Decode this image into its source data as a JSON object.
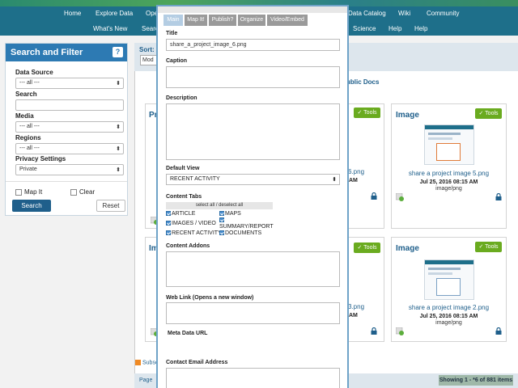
{
  "nav": {
    "row1": [
      "Home",
      "Explore Data",
      "Ope",
      "Data Catalog",
      "Wiki",
      "Community"
    ],
    "row2": [
      "What's New",
      "Searc",
      "Science",
      "Help",
      "Help"
    ]
  },
  "sidebar": {
    "title": "Search and Filter",
    "help_label": "?",
    "data_source": {
      "label": "Data Source",
      "value": "--- all ---"
    },
    "search": {
      "label": "Search",
      "value": ""
    },
    "media": {
      "label": "Media",
      "value": "--- all ---"
    },
    "regions": {
      "label": "Regions",
      "value": "--- all ---"
    },
    "privacy": {
      "label": "Privacy Settings",
      "value": "Private"
    },
    "map_it_label": "Map It",
    "clear_label": "Clear",
    "search_button": "Search",
    "reset_button": "Reset"
  },
  "main": {
    "sort_label": "Sort:",
    "sort_value": "Mod",
    "public_docs": "ublic Docs",
    "partial_left_1": "Pr",
    "partial_left_2": "Im",
    "partial_mid_1": "6.png",
    "partial_mid_2": "3.png",
    "partial_mid_3": "AM",
    "partial_mid_4": "AM",
    "cards": [
      {
        "title": "Image",
        "tools": "Tools",
        "name": "share a project image 5.png",
        "date": "Jul 25, 2016 08:15 AM",
        "type": "image/png"
      },
      {
        "title": "Image",
        "tools": "Tools",
        "name": "share a project image 2.png",
        "date": "Jul 25, 2016 08:15 AM",
        "type": "image/png"
      }
    ],
    "tools_label": "Tools",
    "subscribe": "Subsc",
    "page_label": "Page",
    "showing": "Showing 1 - *6 of 881 items"
  },
  "modal": {
    "tabs": [
      "Main",
      "Map It!",
      "Publish?",
      "Organize",
      "Video/Embed"
    ],
    "title_label": "Title",
    "title_value": "share_a_project_image_6.png",
    "caption_label": "Caption",
    "description_label": "Description",
    "default_view_label": "Default View",
    "default_view_value": "RECENT ACTIVITY",
    "content_tabs_label": "Content Tabs",
    "select_all": "select all / deselect all",
    "content_tabs": [
      "ARTICLE",
      "MAPS",
      "IMAGES / VIDEO",
      "SUMMARY/REPORT",
      "RECENT ACTIVITY",
      "DOCUMENTS"
    ],
    "addons_label": "Content Addons",
    "weblink_label": "Web Link (Opens a new window)",
    "metadata_label": "Meta Data URL",
    "contact_label": "Contact Email Address"
  },
  "colors": {
    "nav_bg": "#1e6f8a",
    "primary": "#1f5f8b",
    "tools_green": "#6aab1f",
    "active_tab": "#b4cde3"
  }
}
